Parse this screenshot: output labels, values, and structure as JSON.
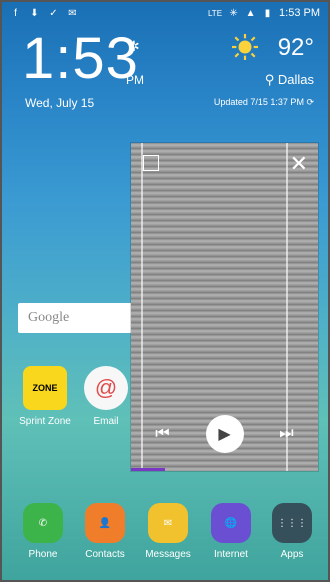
{
  "status": {
    "time": "1:53 PM",
    "network": "LTE"
  },
  "clock": {
    "time": "1:53",
    "ampm": "PM",
    "date": "Wed, July 15"
  },
  "weather": {
    "temp": "92°",
    "city": "Dallas",
    "updated": "Updated 7/15 1:37 PM"
  },
  "search": {
    "label": "Google"
  },
  "apps": {
    "sprint": "Sprint Zone",
    "email": "Email"
  },
  "dock": [
    {
      "label": "Phone"
    },
    {
      "label": "Contacts"
    },
    {
      "label": "Messages"
    },
    {
      "label": "Internet"
    },
    {
      "label": "Apps"
    }
  ],
  "pip": {
    "progress_fraction": 0.18
  }
}
